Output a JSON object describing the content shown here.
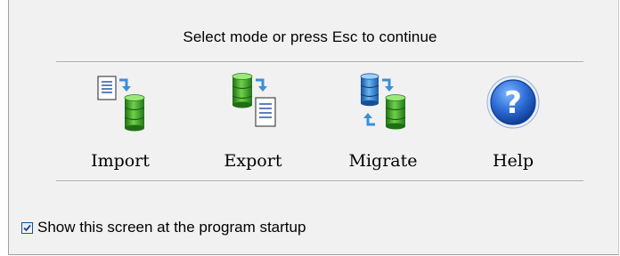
{
  "dialog": {
    "prompt": "Select mode or press Esc to continue"
  },
  "modes": [
    {
      "label": "Import",
      "icon": "import-icon"
    },
    {
      "label": "Export",
      "icon": "export-icon"
    },
    {
      "label": "Migrate",
      "icon": "migrate-icon"
    },
    {
      "label": "Help",
      "icon": "help-icon"
    }
  ],
  "startup": {
    "label": "Show this screen at the program startup",
    "checked": true
  },
  "colors": {
    "database_green": "#3d9b2a",
    "database_blue": "#2a76c9",
    "arrow_blue": "#3a8fd8",
    "help_blue": "#1a5fc4"
  }
}
